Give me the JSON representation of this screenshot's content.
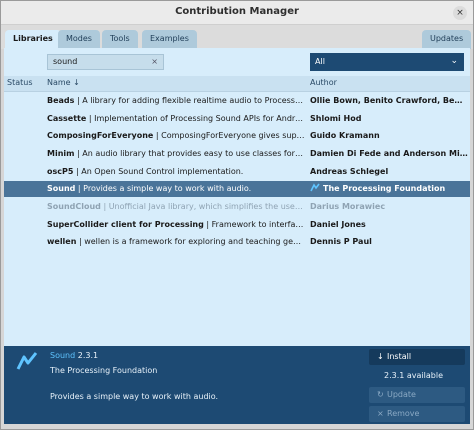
{
  "window": {
    "title": "Contribution Manager",
    "close_glyph": "×"
  },
  "tabs": [
    {
      "label": "Libraries",
      "active": true
    },
    {
      "label": "Modes",
      "active": false
    },
    {
      "label": "Tools",
      "active": false
    },
    {
      "label": "Examples",
      "active": false
    }
  ],
  "updates_tab": {
    "label": "Updates"
  },
  "search": {
    "value": "sound",
    "clear_glyph": "×"
  },
  "category_select": {
    "value": "All",
    "chevron": "⌄"
  },
  "table": {
    "headers": {
      "status": "Status",
      "name": "Name ↓",
      "author": "Author"
    },
    "rows": [
      {
        "name": "Beads",
        "desc": " | A library for adding flexible realtime audio to Processing.",
        "author": "Ollie Bown, Benito Crawford, Ben Po…",
        "state": "normal"
      },
      {
        "name": "Cassette",
        "desc": " | Implementation of Processing Sound APIs for Androi…",
        "author": "Shlomi Hod",
        "state": "normal"
      },
      {
        "name": "ComposingForEveryone",
        "desc": " | ComposingForEveryone gives support…",
        "author": "Guido Kramann",
        "state": "normal"
      },
      {
        "name": "Minim",
        "desc": " | An audio library that provides easy to use classes for pl…",
        "author": "Damien Di Fede and Anderson Mills",
        "state": "normal"
      },
      {
        "name": "oscP5",
        "desc": " | An Open Sound Control implementation.",
        "author": "Andreas Schlegel",
        "state": "normal"
      },
      {
        "name": "Sound",
        "desc": " | Provides a simple way to work with audio.",
        "author": "The Processing Foundation",
        "state": "selected"
      },
      {
        "name": "SoundCloud",
        "desc": " | Unofficial Java library, which simplifies the use o…",
        "author": "Darius Morawiec",
        "state": "dim"
      },
      {
        "name": "SuperCollider client for Processing",
        "desc": " | Framework to interface wit…",
        "author": "Daniel Jones",
        "state": "normal"
      },
      {
        "name": "wellen",
        "desc": " | wellen is a framework for exploring and teaching gener…",
        "author": "Dennis P Paul",
        "state": "normal"
      }
    ]
  },
  "detail": {
    "name": "Sound",
    "version": " 2.3.1",
    "author": "The Processing Foundation",
    "description": "Provides a simple way to work with audio.",
    "install_label": "Install",
    "available_text": "2.3.1 available",
    "update_label": "Update",
    "remove_label": "Remove"
  },
  "colors": {
    "accent": "#1d4a73",
    "selected_row": "#4a7499",
    "link": "#5fc4ff"
  }
}
